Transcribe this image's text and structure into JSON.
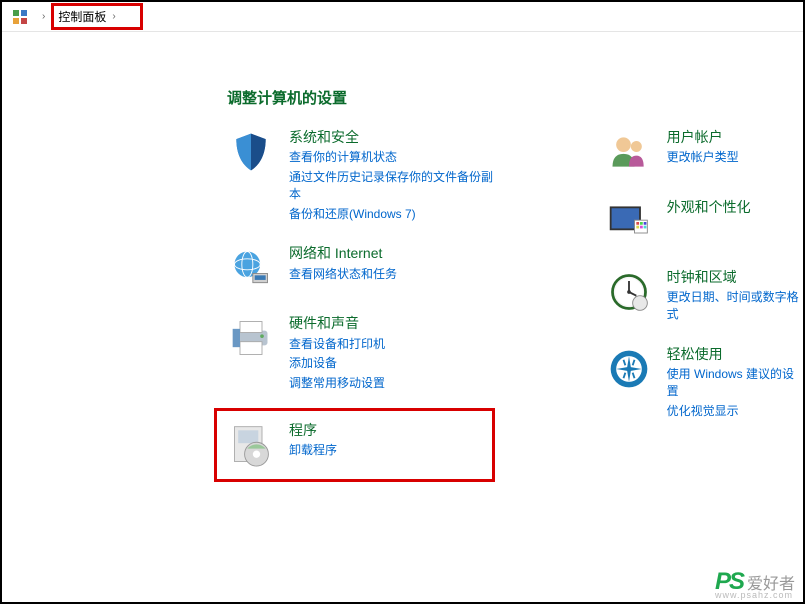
{
  "breadcrumb": {
    "root": "控制面板"
  },
  "page_title": "调整计算机的设置",
  "left": [
    {
      "title": "系统和安全",
      "subs": [
        "查看你的计算机状态",
        "通过文件历史记录保存你的文件备份副本",
        "备份和还原(Windows 7)"
      ]
    },
    {
      "title": "网络和 Internet",
      "subs": [
        "查看网络状态和任务"
      ]
    },
    {
      "title": "硬件和声音",
      "subs": [
        "查看设备和打印机",
        "添加设备",
        "调整常用移动设置"
      ]
    },
    {
      "title": "程序",
      "subs": [
        "卸载程序"
      ]
    }
  ],
  "right": [
    {
      "title": "用户帐户",
      "subs": [
        "更改帐户类型"
      ]
    },
    {
      "title": "外观和个性化",
      "subs": []
    },
    {
      "title": "时钟和区域",
      "subs": [
        "更改日期、时间或数字格式"
      ]
    },
    {
      "title": "轻松使用",
      "subs": [
        "使用 Windows 建议的设置",
        "优化视觉显示"
      ]
    }
  ],
  "watermark": {
    "ps": "PS",
    "cn": "爱好者",
    "url": "www.psahz.com"
  }
}
